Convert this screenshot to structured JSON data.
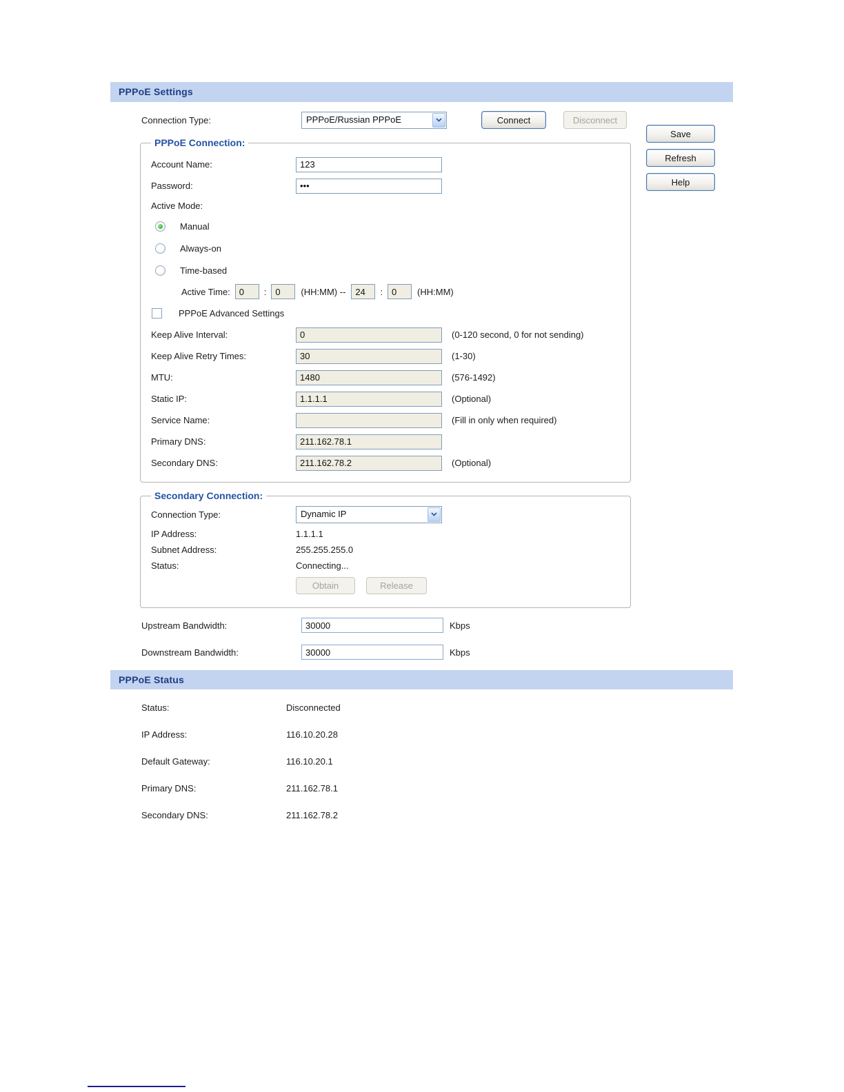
{
  "header": {
    "settings_title": "PPPoE Settings",
    "status_title": "PPPoE Status"
  },
  "connection_type": {
    "label": "Connection Type:",
    "value": "PPPoE/Russian PPPoE"
  },
  "buttons": {
    "connect": "Connect",
    "disconnect": "Disconnect",
    "save": "Save",
    "refresh": "Refresh",
    "help": "Help",
    "obtain": "Obtain",
    "release": "Release"
  },
  "icons": {
    "combo_arrow": "chevron-down"
  },
  "pppoe_connection": {
    "legend": "PPPoE Connection:",
    "account_name": {
      "label": "Account Name:",
      "value": "123"
    },
    "password": {
      "label": "Password:",
      "value": "•••"
    },
    "active_mode": {
      "label": "Active Mode:",
      "options": [
        {
          "label": "Manual",
          "selected": true
        },
        {
          "label": "Always-on",
          "selected": false
        },
        {
          "label": "Time-based",
          "selected": false
        }
      ]
    },
    "active_time": {
      "label": "Active Time:",
      "h1": "0",
      "m1": "0",
      "colon": ":",
      "hhmm1": "(HH:MM) --",
      "h2": "24",
      "m2": "0",
      "hhmm2": "(HH:MM)"
    },
    "advanced_label": "PPPoE Advanced Settings",
    "fields": [
      {
        "label": "Keep Alive Interval:",
        "value": "0",
        "hint": "(0-120 second, 0 for not sending)"
      },
      {
        "label": "Keep Alive Retry Times:",
        "value": "30",
        "hint": "(1-30)"
      },
      {
        "label": "MTU:",
        "value": "1480",
        "hint": "(576-1492)"
      },
      {
        "label": "Static IP:",
        "value": "1.1.1.1",
        "hint": "(Optional)"
      },
      {
        "label": "Service Name:",
        "value": "",
        "hint": "(Fill in only when required)"
      },
      {
        "label": "Primary DNS:",
        "value": "211.162.78.1",
        "hint": ""
      },
      {
        "label": "Secondary DNS:",
        "value": "211.162.78.2",
        "hint": "(Optional)"
      }
    ]
  },
  "secondary_connection": {
    "legend": "Secondary Connection:",
    "connection_type": {
      "label": "Connection Type:",
      "value": "Dynamic IP"
    },
    "rows": [
      {
        "label": "IP Address:",
        "value": "1.1.1.1"
      },
      {
        "label": "Subnet Address:",
        "value": "255.255.255.0"
      },
      {
        "label": "Status:",
        "value": "Connecting..."
      }
    ]
  },
  "bandwidth": {
    "upstream": {
      "label": "Upstream Bandwidth:",
      "value": "30000",
      "unit": "Kbps"
    },
    "downstream": {
      "label": "Downstream Bandwidth:",
      "value": "30000",
      "unit": "Kbps"
    }
  },
  "status_section": {
    "rows": [
      {
        "label": "Status:",
        "value": "Disconnected"
      },
      {
        "label": "IP Address:",
        "value": "116.10.20.28"
      },
      {
        "label": "Default Gateway:",
        "value": "116.10.20.1"
      },
      {
        "label": "Primary DNS:",
        "value": "211.162.78.1"
      },
      {
        "label": "Secondary DNS:",
        "value": "211.162.78.2"
      }
    ]
  },
  "colors": {
    "header_bg": "#c3d4f1",
    "header_text": "#1f3c82",
    "legend_text": "#2452a5",
    "input_border": "#7f9db9",
    "input_readonly_bg": "#f0eee2",
    "radio_selected": "#2eb42e",
    "disabled_text": "#a5a599",
    "bottom_rule": "#1d1d95"
  }
}
